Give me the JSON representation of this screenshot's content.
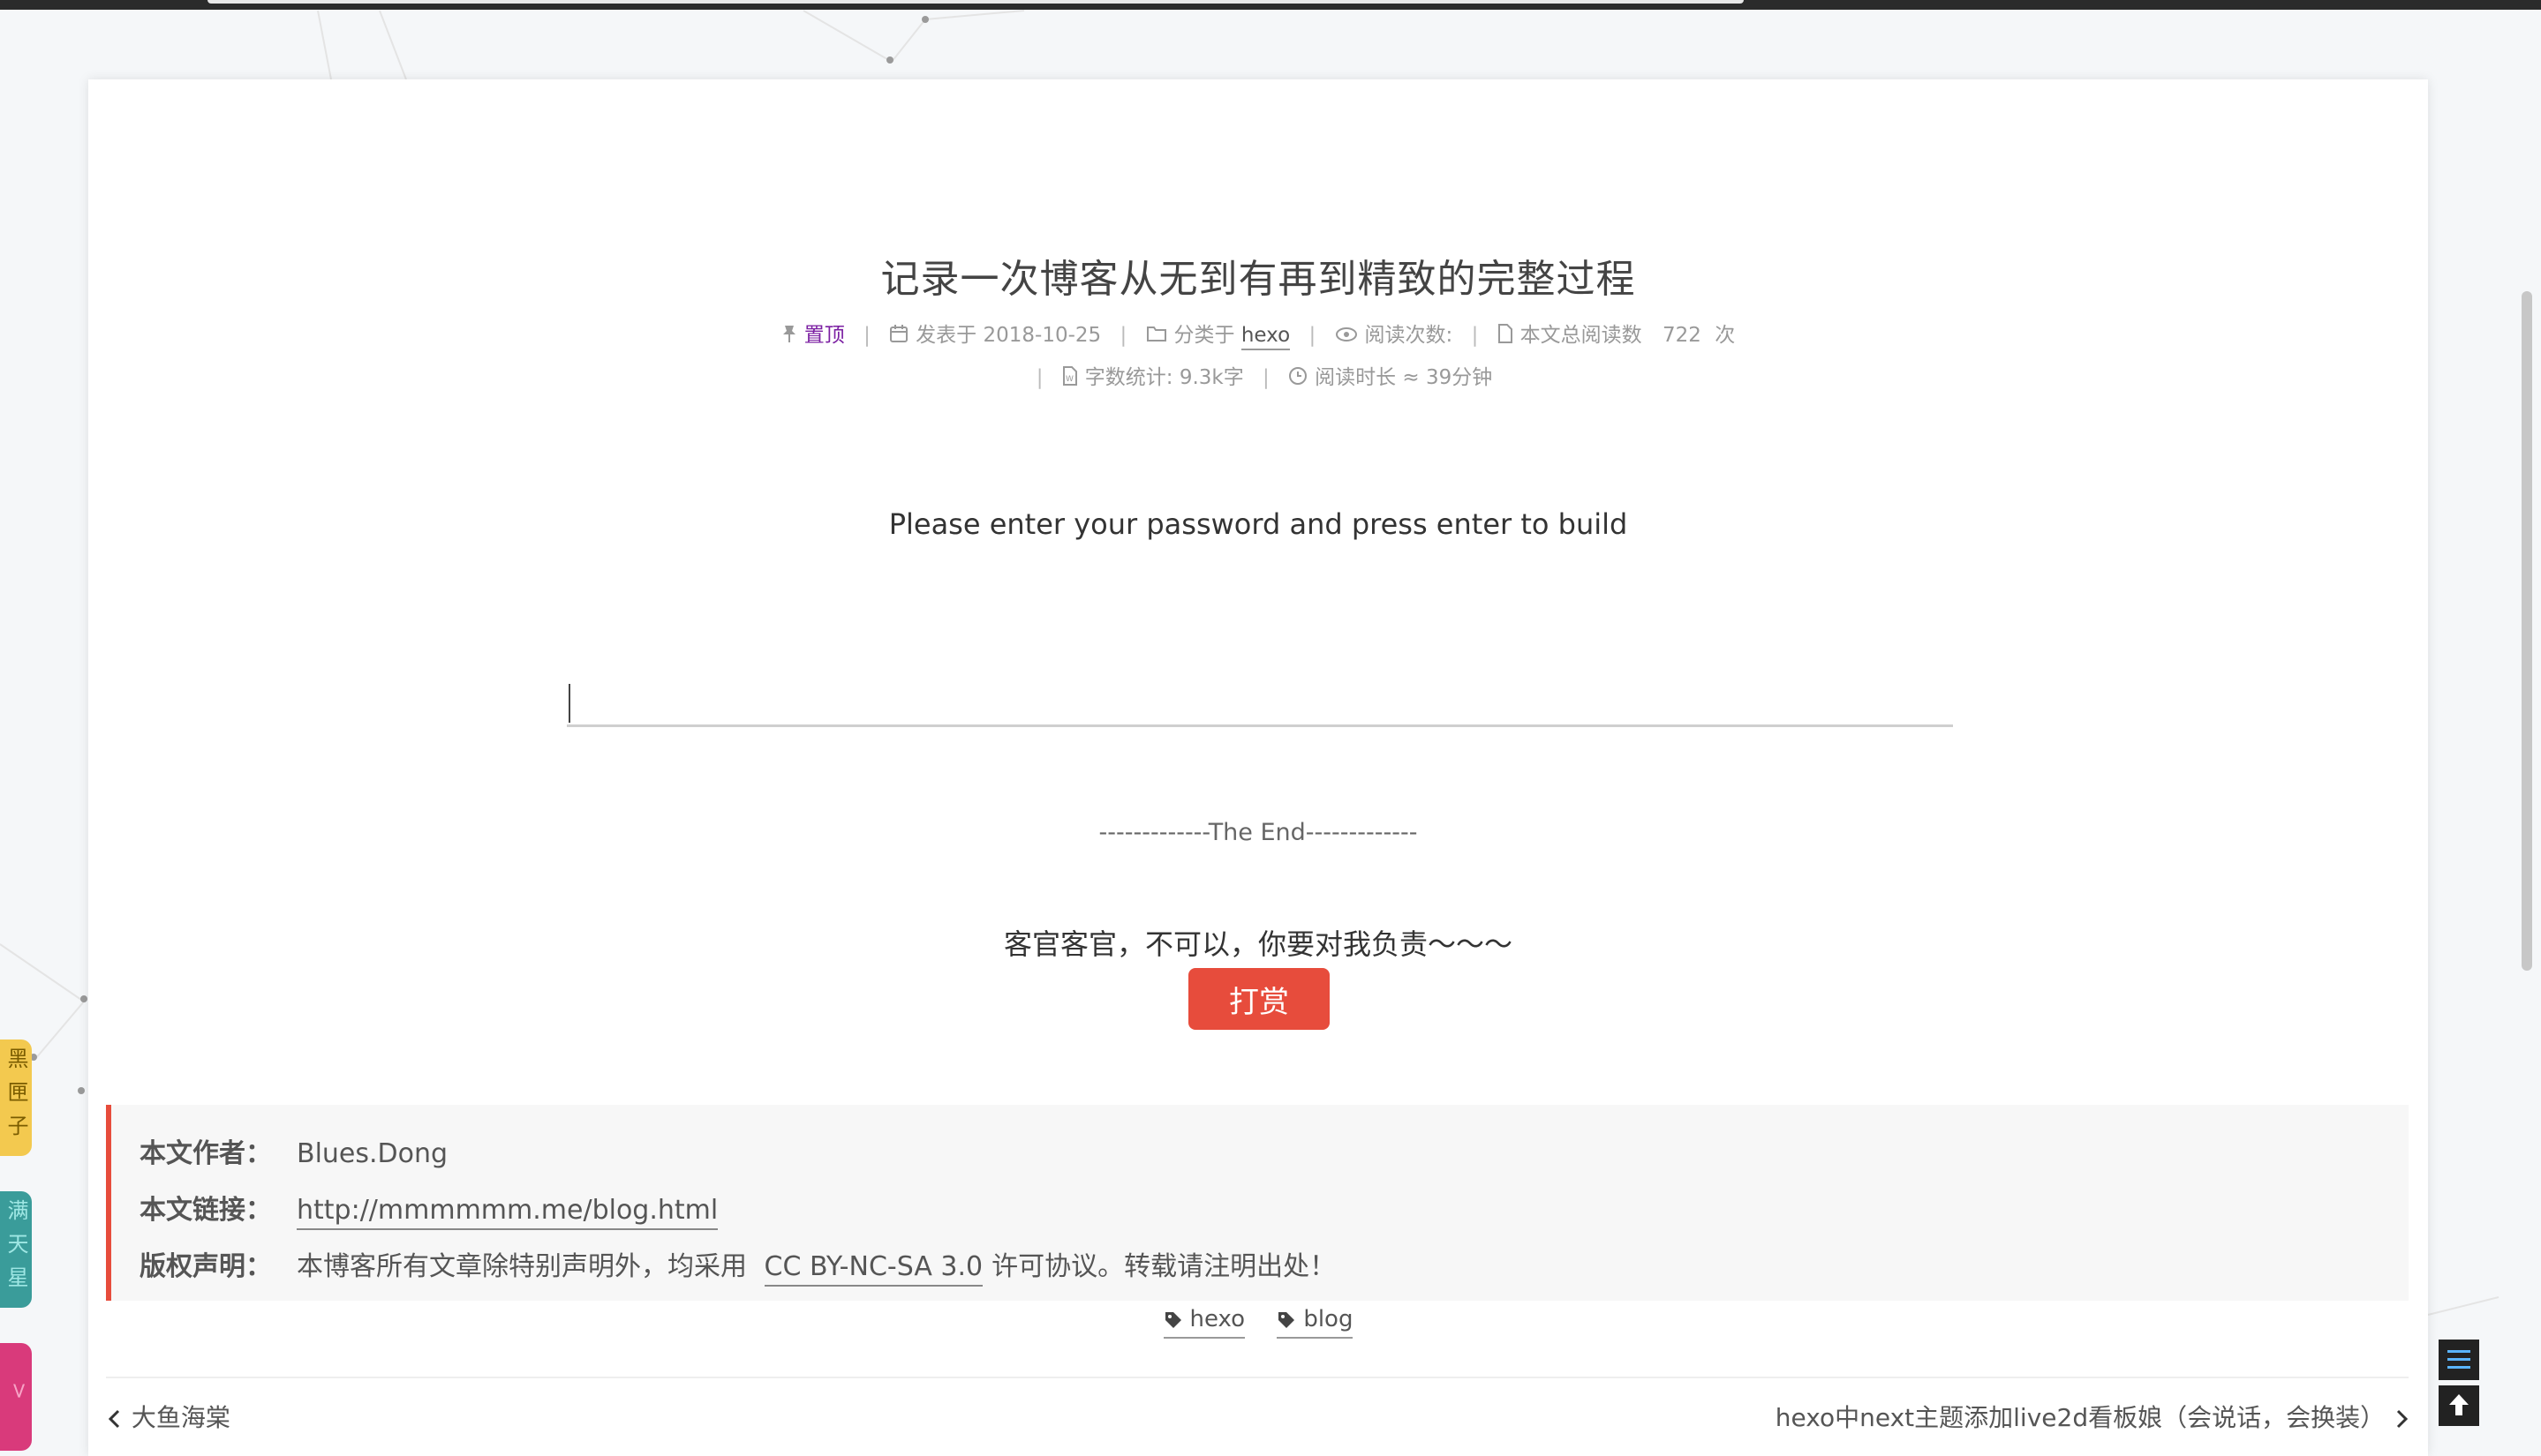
{
  "post": {
    "title": "记录一次博客从无到有再到精致的完整过程",
    "pinned_label": "置顶",
    "posted_label": "发表于 2018-10-25",
    "category_label": "分类于",
    "category": "hexo",
    "views_label": "阅读次数:",
    "total_reads_label": "本文总阅读数",
    "total_reads_value": "722",
    "total_reads_unit": "次",
    "word_count": "字数统计: 9.3k字",
    "read_time": "阅读时长 ≈ 39分钟"
  },
  "encrypt": {
    "prompt": "Please enter your password and press enter to build",
    "value": ""
  },
  "end_text": "-------------The End-------------",
  "reward": {
    "text": "客官客官，不可以，你要对我负责～～～",
    "button": "打赏"
  },
  "copyright": {
    "author_label": "本文作者：",
    "author": "Blues.Dong",
    "link_label": "本文链接：",
    "link": "http://mmmmmm.me/blog.html",
    "license_label": "版权声明：",
    "license_prefix": "本博客所有文章除特别声明外，均采用",
    "license_name": "CC BY-NC-SA 3.0",
    "license_suffix": "许可协议。转载请注明出处！"
  },
  "tags": [
    "hexo",
    "blog"
  ],
  "nav": {
    "prev": "大鱼海棠",
    "next": "hexo中next主题添加live2d看板娘（会说话，会换装）"
  },
  "side_tabs": [
    "黑匣子",
    "满天星",
    ">"
  ],
  "colors": {
    "accent": "#e74c3c",
    "pin": "#7b1fa2",
    "side_tab_1": "#f3c94f",
    "side_tab_2": "#3a9c9a",
    "side_tab_3": "#d93a7b"
  },
  "icons": {
    "pin": "thumbtack-icon",
    "calendar": "calendar-icon",
    "folder": "folder-icon",
    "views": "eye-icon",
    "file": "file-icon",
    "words": "file-word-icon",
    "time": "clock-icon",
    "tag": "tag-icon",
    "prev": "chevron-left-icon",
    "next": "chevron-right-icon",
    "sidebar": "menu-icon",
    "top": "arrow-up-icon"
  }
}
